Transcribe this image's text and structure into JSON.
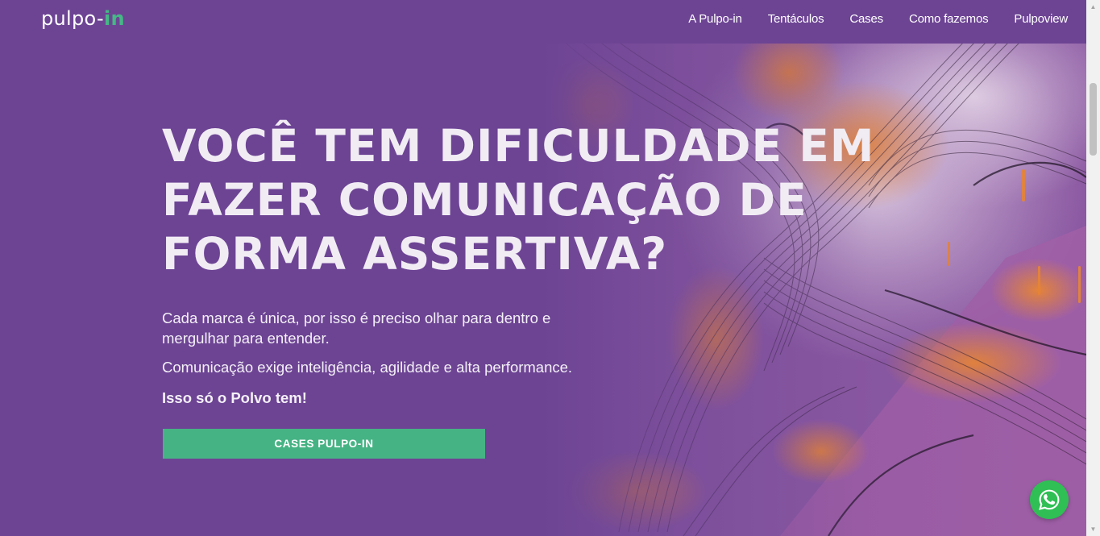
{
  "header": {
    "logo_main": "pulpo-",
    "logo_accent": "in",
    "nav": [
      {
        "label": "A Pulpo-in"
      },
      {
        "label": "Tentáculos"
      },
      {
        "label": "Cases"
      },
      {
        "label": "Como fazemos"
      },
      {
        "label": "Pulpoview"
      }
    ]
  },
  "hero": {
    "title_line1": "VOCÊ TEM DIFICULDADE EM",
    "title_line2": "FAZER COMUNICAÇÃO DE",
    "title_line3": "FORMA ASSERTIVA?",
    "paragraph1": "Cada marca é única, por isso é preciso olhar para dentro e mergulhar para entender.",
    "paragraph2": "Comunicação exige inteligência, agilidade e alta performance.",
    "paragraph3": "Isso só o Polvo tem!",
    "cta_label": "CASES PULPO-IN"
  },
  "colors": {
    "background": "#6d4494",
    "accent": "#46b384",
    "whatsapp": "#2fbf54"
  },
  "icons": {
    "whatsapp": "whatsapp-icon",
    "scroll_up": "triangle-up",
    "scroll_down": "triangle-down"
  }
}
